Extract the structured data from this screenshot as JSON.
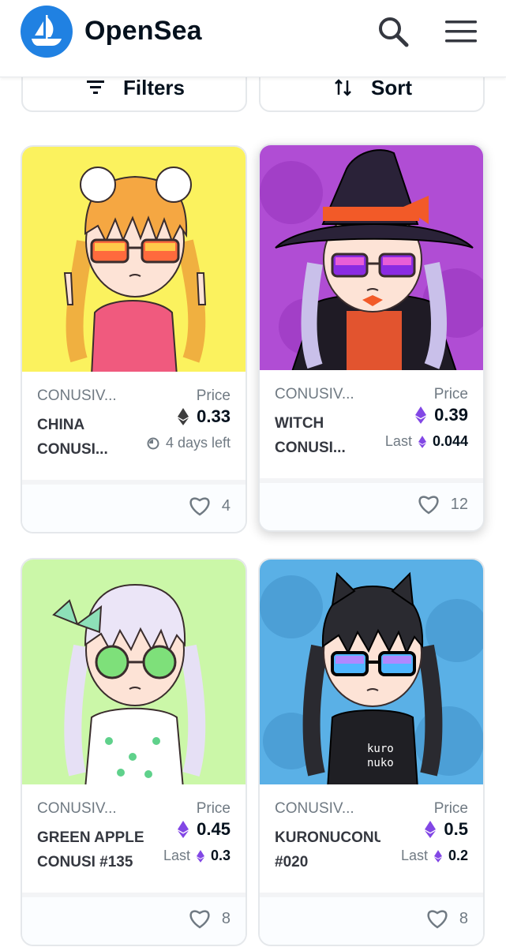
{
  "app": {
    "name": "OpenSea"
  },
  "header": {
    "icons": [
      "opensea-logo",
      "search-icon",
      "menu-icon"
    ]
  },
  "controls": {
    "filters_label": "Filters",
    "sort_label": "Sort"
  },
  "colors": {
    "brand": "#2081e2",
    "text": "#04111d",
    "muted": "#707a83",
    "eth_gray": "#3c3c3d",
    "eth_purple": "#8247e5"
  },
  "cards": [
    {
      "collection": "CONUSIV...",
      "name_line1": "CHINA",
      "name_line2": "CONUSI...",
      "price_label": "Price",
      "price": "0.33",
      "price_icon": "eth-gray",
      "sub_text": "4 days left",
      "sub_icon": "clock-icon",
      "likes": "4",
      "art_bg": "#fbf25e"
    },
    {
      "collection": "CONUSIV...",
      "name_line1": "WITCH",
      "name_line2": "CONUSI...",
      "price_label": "Price",
      "price": "0.39",
      "price_icon": "eth-purple",
      "last_label": "Last",
      "last_value": "0.044",
      "likes": "12",
      "art_bg": "#b04dd4"
    },
    {
      "collection": "CONUSIV...",
      "name_line1": "GREEN APPLE",
      "name_line2": "CONUSI #135",
      "price_label": "Price",
      "price": "0.45",
      "price_icon": "eth-purple",
      "last_label": "Last",
      "last_value": "0.3",
      "likes": "8",
      "art_bg": "#cbf7a8"
    },
    {
      "collection": "CONUSIV...",
      "name_line1": "KURONUCONU",
      "name_line2": "#020",
      "price_label": "Price",
      "price": "0.5",
      "price_icon": "eth-purple",
      "last_label": "Last",
      "last_value": "0.2",
      "likes": "8",
      "art_bg": "#5ab0e6"
    }
  ],
  "artwork": {
    "shirt_text_line1": "kuro",
    "shirt_text_line2": "nuko"
  }
}
